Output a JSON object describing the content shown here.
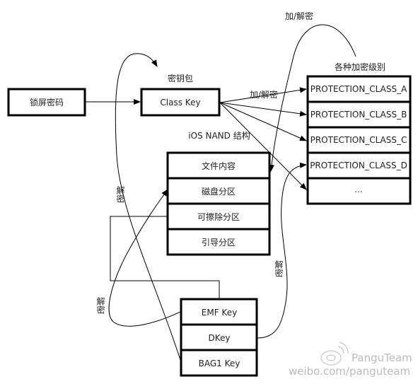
{
  "nodes": {
    "lock_passcode": "锁屏密码",
    "class_key": "Class Key",
    "protection_classes": [
      "PROTECTION_CLASS_A",
      "PROTECTION_CLASS_B",
      "PROTECTION_CLASS_C",
      "PROTECTION_CLASS_D",
      "..."
    ],
    "nand": [
      "文件内容",
      "磁盘分区",
      "可擦除分区",
      "引导分区"
    ],
    "keys": [
      "EMF Key",
      "DKey",
      "BAG1 Key"
    ]
  },
  "labels": {
    "encrypt_decrypt_top": "加/解密",
    "protection_levels": "各种加密级别",
    "keybag": "密钥包",
    "encrypt_decrypt_mid": "加/解密",
    "nand_title": "iOS NAND 结构",
    "decrypt_left_top": "解密",
    "decrypt_left_bottom": "解密",
    "decrypt_right": "解密"
  },
  "watermark": {
    "brand": "PanguTeam",
    "url": "weibo.com/panguteam",
    "icon": "weibo-logo"
  }
}
